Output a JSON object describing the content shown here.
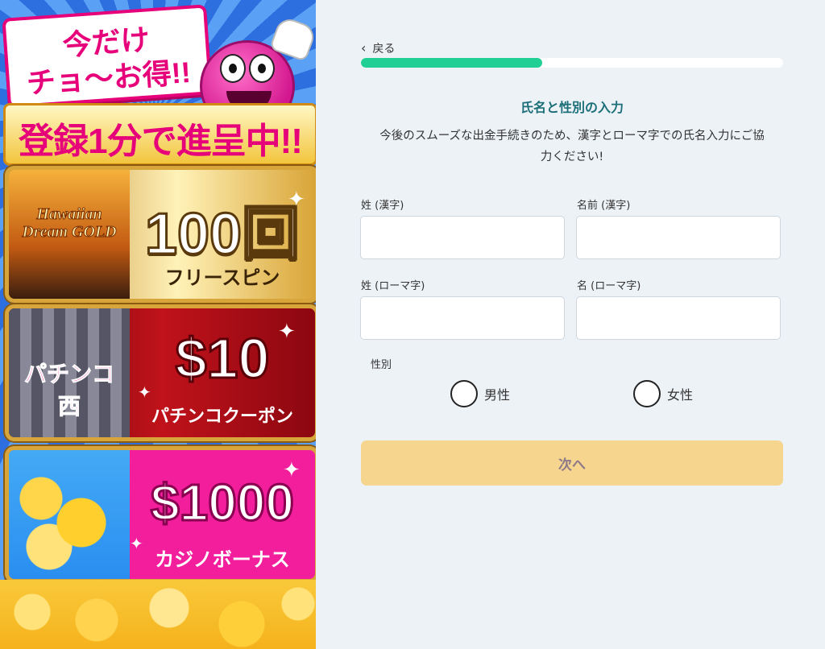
{
  "promo": {
    "headline_1": "今だけ",
    "headline_2": "チョ〜お得!!",
    "ribbon": "登録1分で進呈中!!",
    "cards": [
      {
        "thumb_label": "Hawaiian Dream GOLD",
        "big": "100回",
        "small": "フリースピン"
      },
      {
        "thumb_label": "パチンコ西",
        "big": "$10",
        "small": "パチンコクーポン"
      },
      {
        "thumb_label": "",
        "big": "$1000",
        "small": "カジノボーナス"
      }
    ]
  },
  "form": {
    "back_label": "戻る",
    "progress_fraction": 0.43,
    "progress_color": "#1fcf93",
    "title": "氏名と性別の入力",
    "description_line_1": "今後のスムーズな出金手続きのため、漢字とローマ字での氏名入力にご協",
    "description_line_2": "力ください!",
    "fields": {
      "last_name_kanji": {
        "label": "姓 (漢字)",
        "value": ""
      },
      "first_name_kanji": {
        "label": "名前 (漢字)",
        "value": ""
      },
      "last_name_roman": {
        "label": "姓 (ローマ字)",
        "value": ""
      },
      "first_name_roman": {
        "label": "名 (ローマ字)",
        "value": ""
      }
    },
    "gender": {
      "label": "性別",
      "options": [
        "男性",
        "女性"
      ]
    },
    "next_label": "次へ",
    "accent_color": "#1c6f79",
    "button_color": "#f6d58e"
  }
}
